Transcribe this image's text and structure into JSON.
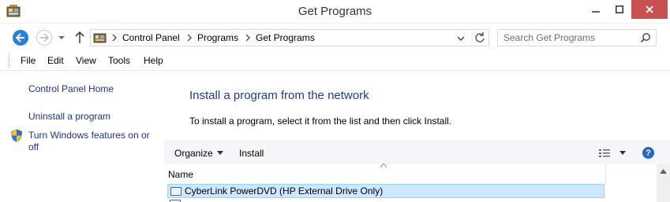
{
  "window": {
    "title": "Get Programs",
    "icons": {
      "app": "control-panel-icon",
      "minimize": "minimize-icon",
      "maximize": "maximize-icon",
      "close": "close-icon"
    },
    "close_color": "#c75050"
  },
  "address_bar": {
    "breadcrumbs": [
      "Control Panel",
      "Programs",
      "Get Programs"
    ],
    "icons": {
      "back": "back-arrow-icon",
      "forward": "forward-arrow-icon",
      "history": "chevron-down-icon",
      "up": "up-arrow-icon",
      "refresh": "refresh-icon"
    }
  },
  "search": {
    "placeholder": "Search Get Programs",
    "icon": "search-icon"
  },
  "menu": [
    "File",
    "Edit",
    "View",
    "Tools",
    "Help"
  ],
  "left_pane": {
    "links": [
      "Control Panel Home",
      "Uninstall a program"
    ],
    "windows_features_line1": "Turn Windows features on or",
    "windows_features_line2": "off",
    "icon": "shield-icon"
  },
  "main": {
    "heading": "Install a program from the network",
    "instructions": "To install a program, select it from the list and then click Install."
  },
  "toolbar": {
    "organize": "Organize",
    "install": "Install",
    "icons": {
      "view": "view-options-icon",
      "help": "help-icon"
    },
    "help_glyph": "?"
  },
  "list": {
    "columns": [
      "Name"
    ],
    "rows": [
      {
        "name": "CyberLink PowerDVD (HP External Drive Only)",
        "selected": true
      }
    ]
  },
  "colors": {
    "accent": "#2a7ed6",
    "link": "#1e3287",
    "heading": "#1e3c8c",
    "selection": "#cce8ff",
    "selection_border": "#99d1ff"
  }
}
